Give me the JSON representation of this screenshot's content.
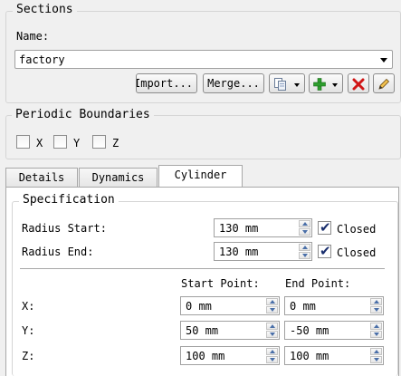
{
  "sections": {
    "title": "Sections",
    "name_label": "Name:",
    "name_value": "factory",
    "import_label": "Import...",
    "merge_label": "Merge...",
    "copy_icon": "copy-sections-icon",
    "add_icon": "add-icon",
    "delete_icon": "delete-icon",
    "edit_icon": "pencil-icon"
  },
  "periodic": {
    "title": "Periodic Boundaries",
    "x_label": "X",
    "y_label": "Y",
    "z_label": "Z",
    "x_checked": false,
    "y_checked": false,
    "z_checked": false
  },
  "tabs": [
    {
      "label": "Details",
      "active": false
    },
    {
      "label": "Dynamics",
      "active": false
    },
    {
      "label": "Cylinder",
      "active": true
    }
  ],
  "specification": {
    "title": "Specification",
    "radius_start_label": "Radius Start:",
    "radius_start_value": "130 mm",
    "radius_start_closed_label": "Closed",
    "radius_start_closed": true,
    "radius_end_label": "Radius End:",
    "radius_end_value": "130 mm",
    "radius_end_closed_label": "Closed",
    "radius_end_closed": true,
    "start_point_header": "Start Point:",
    "end_point_header": "End Point:",
    "rows": [
      {
        "label": "X:",
        "start": "0 mm",
        "end": "0 mm"
      },
      {
        "label": "Y:",
        "start": "50 mm",
        "end": "-50 mm"
      },
      {
        "label": "Z:",
        "start": "100 mm",
        "end": "100 mm"
      }
    ]
  }
}
